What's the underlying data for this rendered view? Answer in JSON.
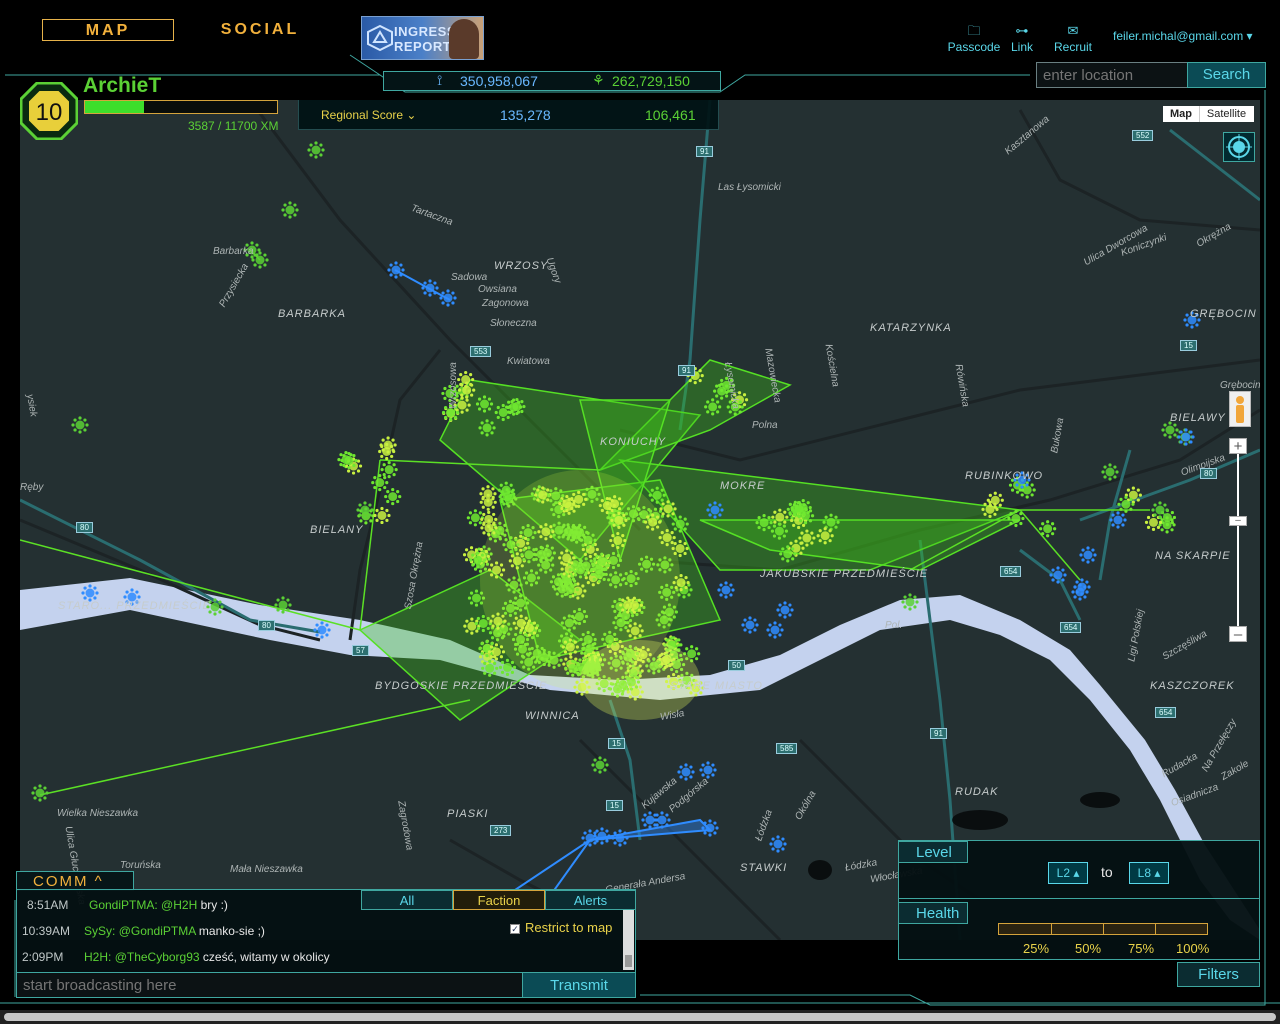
{
  "nav": {
    "map_label": "MAP",
    "social_label": "SOCIAL",
    "report_line1": "INGRESS",
    "report_line2": "REPORT"
  },
  "top_links": {
    "passcode": "Passcode",
    "link": "Link",
    "recruit": "Recruit",
    "user": "feiler.michal@gmail.com ▾"
  },
  "icons": {
    "passcode": "briefcase-icon",
    "link": "link-icon",
    "recruit": "envelope-icon",
    "enlightened": "enlightened-icon",
    "resistance": "resistance-icon"
  },
  "global_score": {
    "enlightened": "350,958,067",
    "resistance": "262,729,150"
  },
  "search": {
    "placeholder": "enter location",
    "button": "Search"
  },
  "agent": {
    "level": "10",
    "name": "ArchieT",
    "xm": "3587 / 11700 XM",
    "xm_fraction": 0.3066
  },
  "regional": {
    "label": "Regional Score ⌄",
    "resistance": "135,278",
    "enlightened": "106,461"
  },
  "map": {
    "map_btn": "Map",
    "satellite_btn": "Satellite",
    "labels": [
      {
        "t": "Las Łysomicki"
      },
      {
        "t": "WRZOSY"
      },
      {
        "t": "BARBARKA"
      },
      {
        "t": "Barbarka"
      },
      {
        "t": "Owsiana"
      },
      {
        "t": "Sadowa"
      },
      {
        "t": "Zagonowa"
      },
      {
        "t": "Słoneczna"
      },
      {
        "t": "Kwiatowa"
      },
      {
        "t": "KATARZYNKA"
      },
      {
        "t": "GRĘBOCIN NAD STRUGĄ"
      },
      {
        "t": "BIELAWY"
      },
      {
        "t": "KONIUCHY"
      },
      {
        "t": "MOKRE"
      },
      {
        "t": "RUBINKOWO"
      },
      {
        "t": "Olimpijska"
      },
      {
        "t": "BIELANY"
      },
      {
        "t": "NA SKARPIE"
      },
      {
        "t": "JAKUBSKIE PRZEDMIEŚCIE"
      },
      {
        "t": "STARO... PRZEDMIEŚCIE"
      },
      {
        "t": "BYDGOSKIE PRZEDMIEŚCIE"
      },
      {
        "t": "STARE MIASTO"
      },
      {
        "t": "Wisła"
      },
      {
        "t": "KASZCZOREK"
      },
      {
        "t": "PIASKI"
      },
      {
        "t": "RUDAK"
      },
      {
        "t": "STAWKI"
      },
      {
        "t": "Wielka Nieszawka"
      },
      {
        "t": "Mała Nieszawka"
      },
      {
        "t": "Toruńska"
      },
      {
        "t": "Generała Andersa"
      },
      {
        "t": "Polna"
      },
      {
        "t": "Okólna"
      },
      {
        "t": "Łódzka"
      },
      {
        "t": "Kujawska"
      },
      {
        "t": "Rudacka"
      },
      {
        "t": "Osiadnicza"
      },
      {
        "t": "Ligi Polskiej"
      },
      {
        "t": "Szczęśliwa"
      },
      {
        "t": "Rówińska"
      },
      {
        "t": "Koniczynki"
      },
      {
        "t": "Okrężna"
      },
      {
        "t": "Ulica Dworcowa"
      },
      {
        "t": "Kasztanowa"
      },
      {
        "t": "Przysiecka"
      },
      {
        "t": "Wrzosowa"
      },
      {
        "t": "Szosa Okrężna"
      },
      {
        "t": "Bukowa"
      },
      {
        "t": "Mazowiecka"
      },
      {
        "t": "Kościelna"
      },
      {
        "t": "Zagrodowa"
      },
      {
        "t": "Ulica Głuchowska"
      },
      {
        "t": "Łódzka"
      },
      {
        "t": "Włocławska"
      },
      {
        "t": "Na Przełęczy"
      },
      {
        "t": "Zakole"
      },
      {
        "t": "Podgórska"
      },
      {
        "t": "Łysomicka"
      },
      {
        "t": "Tartaczna"
      },
      {
        "t": "Ugory"
      },
      {
        "t": "Grębocin"
      },
      {
        "t": "Pol."
      },
      {
        "t": "WINNICA"
      },
      {
        "t": "Ręby"
      },
      {
        "t": "ysiek"
      },
      {
        "t": "nowa"
      }
    ],
    "shields": [
      "91",
      "553",
      "91",
      "552",
      "15",
      "80",
      "80",
      "80",
      "654",
      "654",
      "654",
      "15",
      "91",
      "585",
      "273",
      "15",
      "57",
      "50"
    ]
  },
  "comm": {
    "tab": "COMM ^",
    "tabs": [
      "All",
      "Faction",
      "Alerts"
    ],
    "restrict": "Restrict to map",
    "messages": [
      {
        "time": "8:51AM",
        "nick": "GondiPTMA:",
        "mention": "@H2H",
        "text": " bry :)"
      },
      {
        "time": "10:39AM",
        "nick": "SySy:",
        "mention": "@GondiPTMA",
        "text": " manko-sie ;)"
      },
      {
        "time": "2:09PM",
        "nick": "H2H:",
        "mention": "@TheCyborg93",
        "text": " cześć, witamy w okolicy"
      }
    ],
    "placeholder": "start broadcasting here",
    "transmit": "Transmit"
  },
  "filters": {
    "level_tab": "Level",
    "from": "L2 ▴",
    "to_label": "to",
    "to": "L8 ▴",
    "health_tab": "Health",
    "health_marks": [
      "25%",
      "50%",
      "75%",
      "100%"
    ],
    "filters_btn": "Filters"
  },
  "colors": {
    "accent": "#3fa7a0",
    "enlightened": "#5bd135",
    "resistance": "#2f8cff",
    "gold": "#e9d24a",
    "river": "#c4d2ee",
    "map_bg": "#243032"
  }
}
